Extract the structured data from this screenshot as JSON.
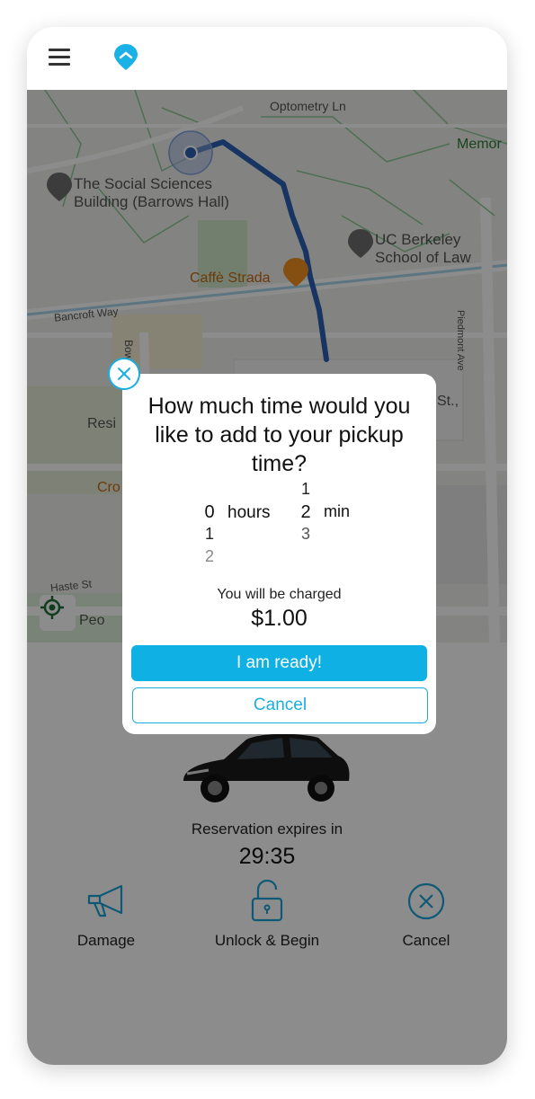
{
  "header": {
    "menu_icon": "hamburger-menu-icon",
    "logo_icon": "location-marker-logo-icon"
  },
  "map": {
    "labels": {
      "optometry": "Optometry Ln",
      "memorial": "Memor",
      "social_sciences_1": "The Social Sciences",
      "social_sciences_2": "Building (Barrows Hall)",
      "berkeley_law_1": "UC Berkeley",
      "berkeley_law_2": "School of Law",
      "caffe": "Caffè Strada",
      "bancroft": "Bancroft Way",
      "piedmont": "Piedmont Ave",
      "bowditch": "Bowdi",
      "st": "St.,",
      "resi": "Resi",
      "cro": "Cro",
      "haste": "Haste St",
      "peo": "Peo"
    },
    "route_color": "#2c5fb3",
    "locate_icon": "crosshair-locate-icon"
  },
  "reservation": {
    "expires_label": "Reservation expires in",
    "timer": "29:35"
  },
  "actions": [
    {
      "label": "Damage",
      "icon": "megaphone-icon"
    },
    {
      "label": "Unlock & Begin",
      "icon": "unlock-icon"
    },
    {
      "label": "Cancel",
      "icon": "cancel-circle-icon"
    }
  ],
  "modal": {
    "title": "How much time would you like to add to your pickup time?",
    "hours": {
      "above": "",
      "selected": "0",
      "below1": "1",
      "below2": "2",
      "unit": "hours"
    },
    "minutes": {
      "above": "1",
      "selected": "2",
      "below1": "3",
      "unit": "min"
    },
    "charged_label": "You will be charged",
    "price": "$1.00",
    "ready_label": "I am ready!",
    "cancel_label": "Cancel",
    "close_icon": "close-x-icon"
  },
  "colors": {
    "accent": "#19aee0",
    "accent_button": "#0fb0e3",
    "overlay": "rgba(0,0,0,0.45)"
  }
}
